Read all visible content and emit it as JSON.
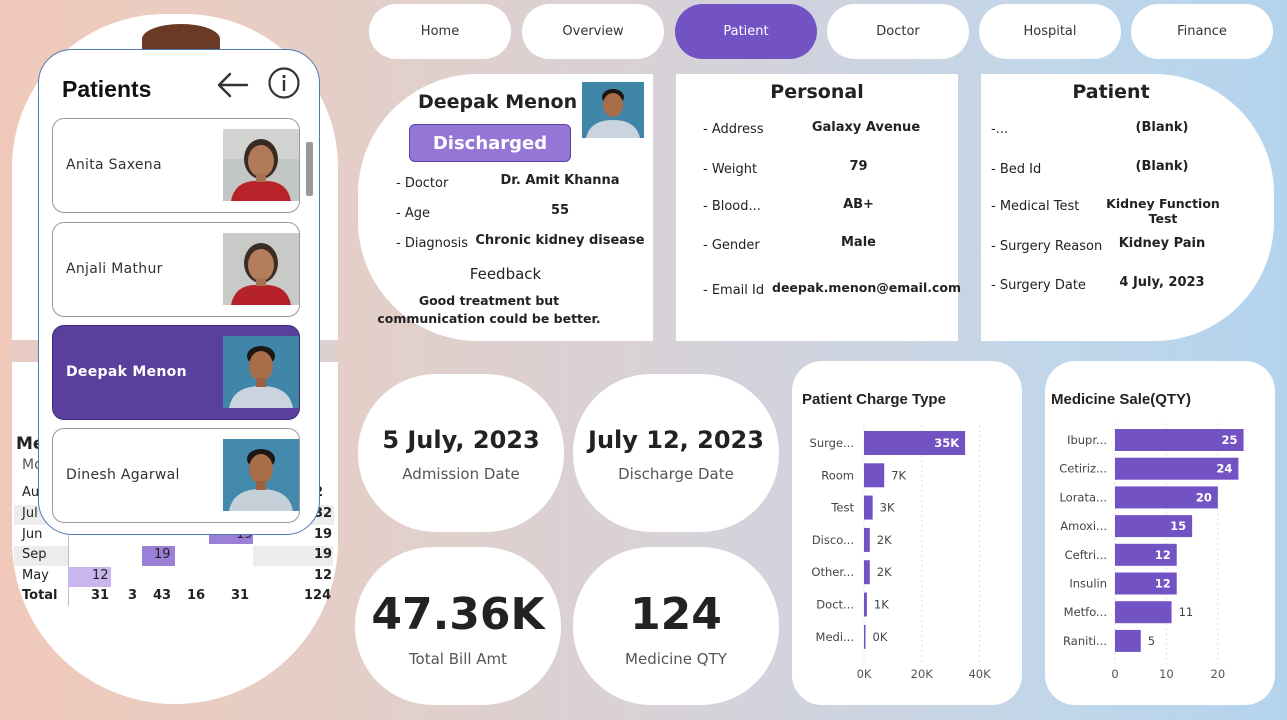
{
  "nav": {
    "items": [
      "Home",
      "Overview",
      "Patient",
      "Doctor",
      "Hospital",
      "Finance"
    ],
    "active": "Patient"
  },
  "background_table": {
    "title_partial": "Me",
    "subtitle_partial": "Mo",
    "rows": [
      {
        "label": "Aug",
        "partial": "Au",
        "values": [
          "",
          "",
          "",
          "",
          "",
          ""
        ],
        "total": "2"
      },
      {
        "label": "Jul",
        "partial": "Jul",
        "values": [
          "",
          "",
          "",
          "",
          "",
          ""
        ],
        "total": "32"
      },
      {
        "label": "Jun",
        "partial": "Jun",
        "values": [
          "",
          "",
          "",
          "",
          "19",
          ""
        ],
        "total": "19"
      },
      {
        "label": "Sep",
        "partial": "Sep",
        "values": [
          "",
          "",
          "19",
          "",
          "",
          ""
        ],
        "total": "19"
      },
      {
        "label": "May",
        "partial": "May",
        "values": [
          "12",
          "",
          "",
          "",
          "",
          ""
        ],
        "total": "12"
      }
    ],
    "total_row": {
      "label": "Total",
      "values": [
        "31",
        "3",
        "43",
        "16",
        "31"
      ],
      "total": "124"
    }
  },
  "patient_list": {
    "title": "Patients",
    "patients": [
      {
        "name": "Anita Saxena",
        "gender": "female",
        "selected": false
      },
      {
        "name": "Anjali Mathur",
        "gender": "female",
        "selected": false
      },
      {
        "name": "Deepak Menon",
        "gender": "male",
        "selected": true
      },
      {
        "name": "Dinesh Agarwal",
        "gender": "male",
        "selected": false
      }
    ]
  },
  "profile": {
    "name": "Deepak Menon",
    "status": "Discharged",
    "fields": [
      {
        "label": "- Doctor",
        "value": "Dr. Amit Khanna"
      },
      {
        "label": "- Age",
        "value": "55"
      },
      {
        "label": "- Diagnosis",
        "value": "Chronic kidney disease"
      }
    ],
    "feedback_label": "Feedback",
    "feedback_line1": "Good treatment but",
    "feedback_line2": "communication could be better."
  },
  "personal": {
    "title": "Personal",
    "fields": [
      {
        "label": "- Address",
        "value": "Galaxy Avenue"
      },
      {
        "label": "- Weight",
        "value": "79"
      },
      {
        "label": "- Blood...",
        "value": "AB+"
      },
      {
        "label": "- Gender",
        "value": "Male"
      },
      {
        "label": "- Email Id",
        "value": "deepak.menon@email.com"
      }
    ]
  },
  "patient_info": {
    "title": "Patient",
    "fields": [
      {
        "label": "-...",
        "value": "(Blank)"
      },
      {
        "label": "- Bed Id",
        "value": "(Blank)"
      },
      {
        "label": "- Medical Test",
        "value": "Kidney Function Test"
      },
      {
        "label": "- Surgery Reason",
        "value": "Kidney Pain"
      },
      {
        "label": "- Surgery Date",
        "value": "4 July, 2023"
      }
    ]
  },
  "kpis": {
    "admission": {
      "value": "5 July, 2023",
      "label": "Admission Date"
    },
    "discharge": {
      "value": "July 12, 2023",
      "label": "Discharge Date"
    },
    "bill": {
      "value": "47.36K",
      "label": "Total Bill Amt"
    },
    "medicine": {
      "value": "124",
      "label": "Medicine QTY"
    }
  },
  "chart_data": [
    {
      "type": "bar",
      "orientation": "horizontal",
      "title": "Patient Charge Type",
      "categories": [
        "Surge...",
        "Room",
        "Test",
        "Disco...",
        "Other...",
        "Doct...",
        "Medi..."
      ],
      "values": [
        35000,
        7000,
        3000,
        2000,
        2000,
        1000,
        0
      ],
      "data_labels": [
        "35K",
        "7K",
        "3K",
        "2K",
        "2K",
        "1K",
        "0K"
      ],
      "xlim": [
        0,
        45000
      ],
      "ticks": [
        "0K",
        "20K",
        "40K"
      ],
      "tick_values": [
        0,
        20000,
        40000
      ],
      "bar_color": "#7352c4"
    },
    {
      "type": "bar",
      "orientation": "horizontal",
      "title": "Medicine Sale(QTY)",
      "categories": [
        "Ibupr...",
        "Cetiriz...",
        "Lorata...",
        "Amoxi...",
        "Ceftri...",
        "Insulin",
        "Metfo...",
        "Raniti..."
      ],
      "values": [
        25,
        24,
        20,
        15,
        12,
        12,
        11,
        5
      ],
      "data_labels": [
        "25",
        "24",
        "20",
        "15",
        "12",
        "12",
        "11",
        "5"
      ],
      "xlim": [
        0,
        28
      ],
      "ticks": [
        "0",
        "10",
        "20"
      ],
      "tick_values": [
        0,
        10,
        20
      ],
      "bar_color": "#7352c4"
    }
  ],
  "colors": {
    "accent": "#7352c4",
    "selected_card": "#5b3f9d",
    "status_badge": "#9575d6",
    "heat_cell": "#9c80d8",
    "heat_light": "#c8b6ec"
  }
}
